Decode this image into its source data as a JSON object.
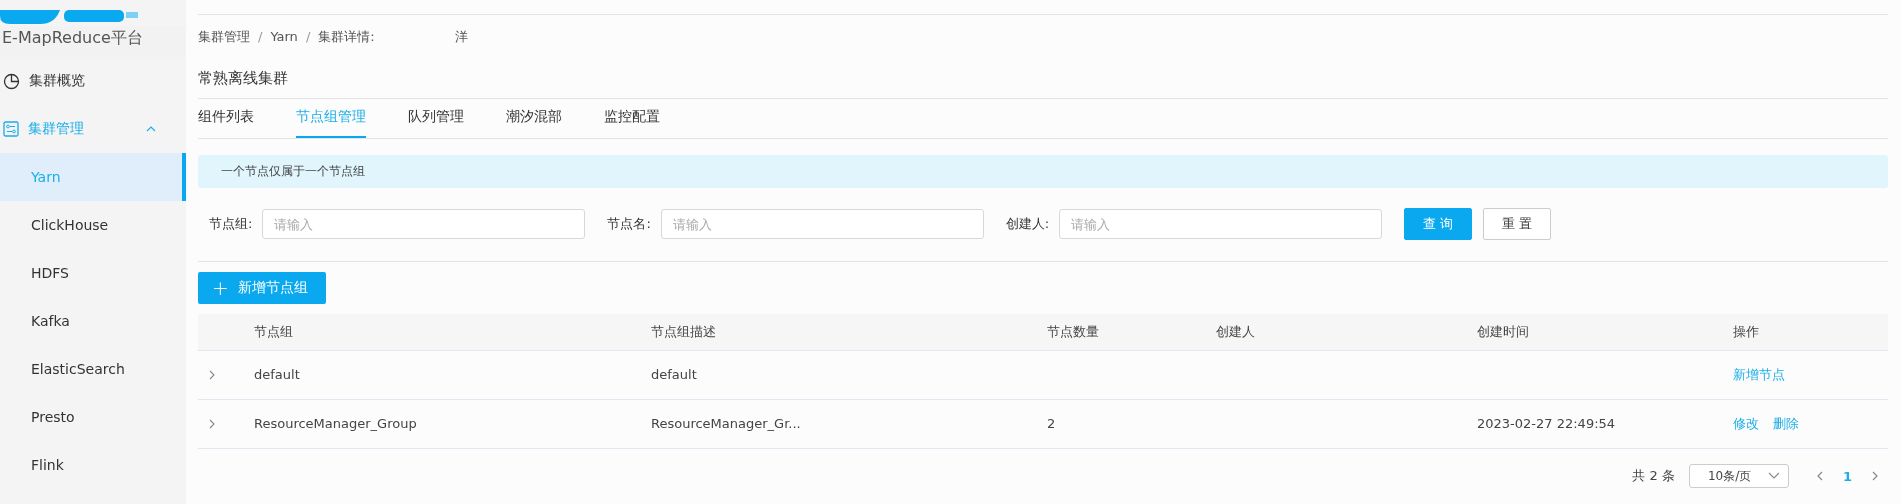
{
  "platform_title": "E-MapReduce平台",
  "sidebar": {
    "items": [
      {
        "label": "集群概览",
        "kind": "top"
      },
      {
        "label": "集群管理",
        "kind": "group",
        "expanded": true,
        "children": [
          {
            "label": "Yarn",
            "selected": true
          },
          {
            "label": "ClickHouse",
            "selected": false
          },
          {
            "label": "HDFS",
            "selected": false
          },
          {
            "label": "Kafka",
            "selected": false
          },
          {
            "label": "ElasticSearch",
            "selected": false
          },
          {
            "label": "Presto",
            "selected": false
          },
          {
            "label": "Flink",
            "selected": false
          }
        ]
      }
    ]
  },
  "breadcrumb": [
    "集群管理",
    "Yarn",
    "集群详情:"
  ],
  "breadcrumb_separators": [
    "/",
    "/"
  ],
  "breadcrumb_tail": "洋",
  "page_title": "常熟离线集群",
  "tabs": [
    {
      "label": "组件列表",
      "selected": false
    },
    {
      "label": "节点组管理",
      "selected": true
    },
    {
      "label": "队列管理",
      "selected": false
    },
    {
      "label": "潮汐混部",
      "selected": false
    },
    {
      "label": "监控配置",
      "selected": false
    }
  ],
  "alert": "一个节点仅属于一个节点组",
  "filters": [
    {
      "label": "节点组:",
      "placeholder": "请输入"
    },
    {
      "label": "节点名:",
      "placeholder": "请输入"
    },
    {
      "label": "创建人:",
      "placeholder": "请输入"
    }
  ],
  "filter_buttons": [
    {
      "label": "查 询",
      "kind": "primary"
    },
    {
      "label": "重 置",
      "kind": "default"
    }
  ],
  "add_button": {
    "icon": "+",
    "label": "新增节点组"
  },
  "table": {
    "columns": [
      "节点组",
      "节点组描述",
      "节点数量",
      "创建人",
      "创建时间",
      "操作"
    ],
    "rows": [
      {
        "expanded": false,
        "cells": [
          "default",
          "default",
          "",
          "",
          "",
          ""
        ],
        "actions": [
          "新增节点"
        ]
      },
      {
        "expanded": false,
        "cells": [
          "ResourceManager_Group",
          "ResourceManager_Gr...",
          "2",
          "",
          "2023-02-27 22:49:54",
          ""
        ],
        "actions": [
          "修改",
          "删除"
        ]
      }
    ]
  },
  "pagination": {
    "total": "共 2 条",
    "page_size": "10条/页",
    "pages": [
      {
        "label": "1",
        "selected": true
      }
    ]
  }
}
